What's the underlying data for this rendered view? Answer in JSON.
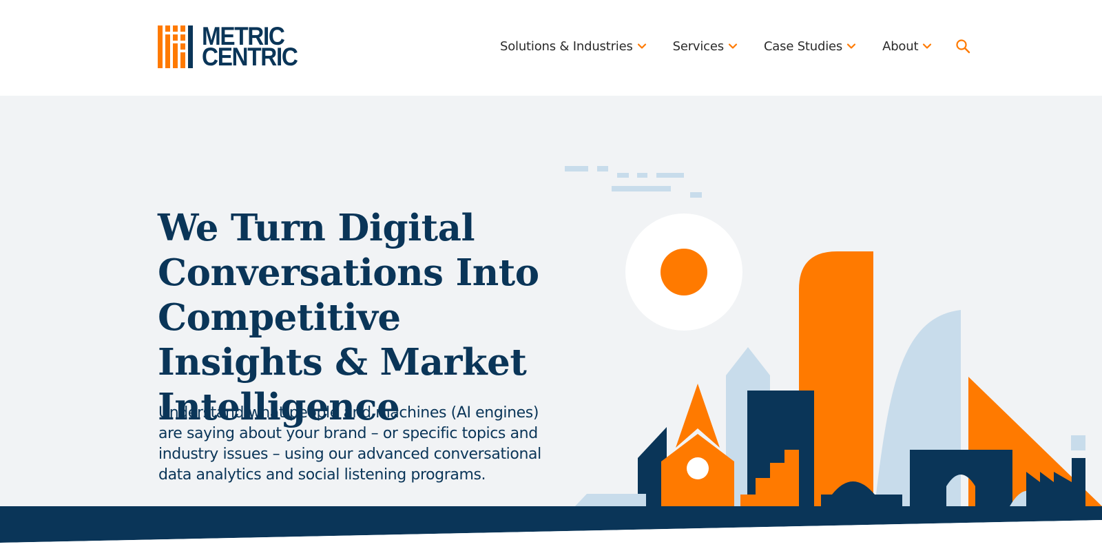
{
  "brand": {
    "line1": "METRIC",
    "line2": "CENTRIC",
    "colors": {
      "orange": "#ff7a00",
      "navy": "#0a3558",
      "light_blue": "#c8dceb",
      "hero_bg": "#f1f3f5"
    }
  },
  "nav": {
    "items": [
      {
        "label": "Solutions & Industries",
        "icon": "chevron-down-icon"
      },
      {
        "label": "Services",
        "icon": "chevron-down-icon"
      },
      {
        "label": "Case Studies",
        "icon": "chevron-down-icon"
      },
      {
        "label": "About",
        "icon": "chevron-down-icon"
      }
    ],
    "search_icon": "search-icon"
  },
  "hero": {
    "title": "We Turn Digital Conversations Into Competitive Insights & Market Intelligence",
    "subtitle": "Understand what people and machines (AI engines) are saying about your brand – or specific topics and industry issues – using our advanced conversational data analytics and social listening programs."
  }
}
